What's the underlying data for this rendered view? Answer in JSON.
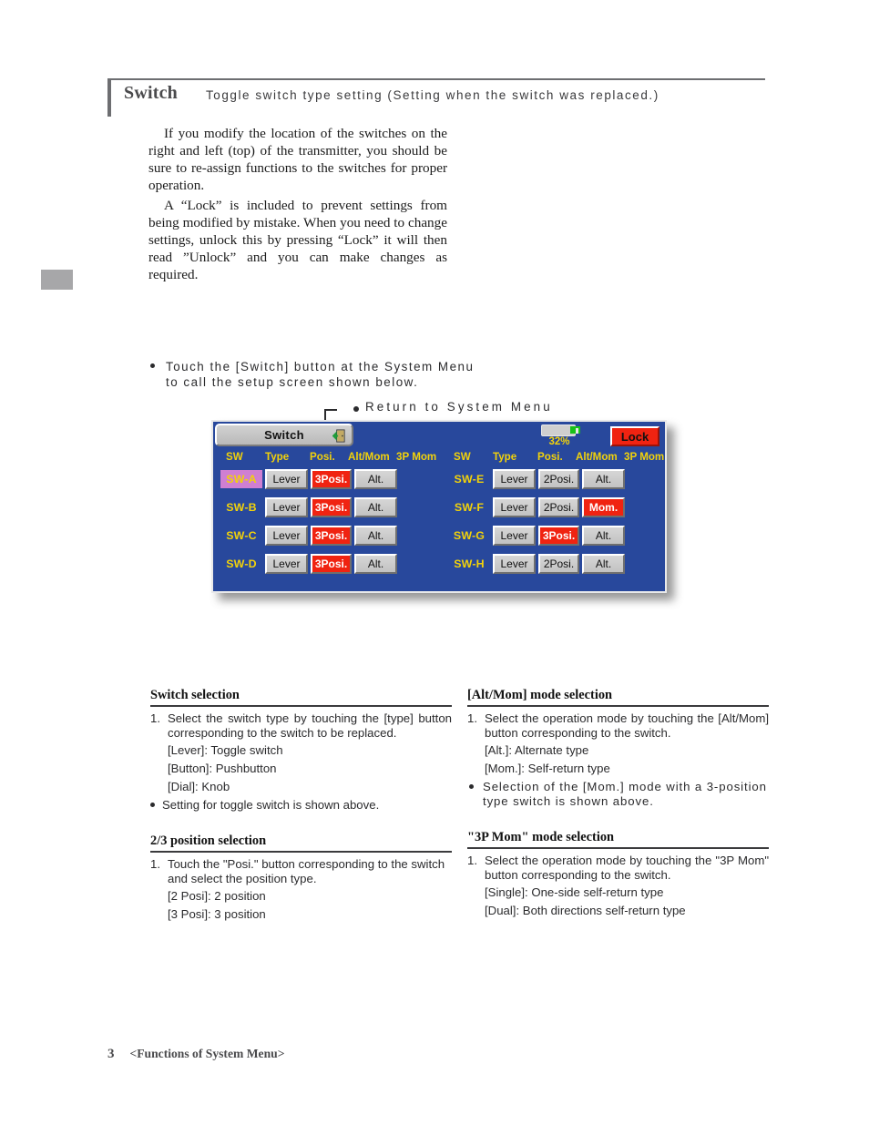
{
  "header": {
    "title": "Switch",
    "subtitle": "Toggle switch type setting (Setting when the switch was replaced.)"
  },
  "intro": {
    "p1": "If you modify the location of the switches on the right and left (top) of the transmitter, you should be sure to re-assign functions to the switches for proper operation.",
    "p2": "A “Lock” is included to prevent settings from being modified by mistake. When you need to change settings, unlock this by pressing “Lock” it will then read ”Unlock” and you can make changes as required."
  },
  "touch_note": "Touch the [Switch] button at the System Menu to call the setup screen shown below.",
  "callout": {
    "label": "Return to System Menu"
  },
  "lcd": {
    "title": "Switch",
    "exit_icon": "exit-door-icon",
    "battery": {
      "percent_label": "32%",
      "level": 32,
      "fill_color": "#18c218"
    },
    "lock_button": "Lock",
    "column_headers": [
      "SW",
      "Type",
      "Posi.",
      "Alt/Mom",
      "3P Mom"
    ],
    "left_rows": [
      {
        "sw": "SW-A",
        "selected": true,
        "type": "Lever",
        "type_on": false,
        "posi": "3Posi.",
        "posi_on": true,
        "altmom": "Alt.",
        "altmom_on": false,
        "p3mom": ""
      },
      {
        "sw": "SW-B",
        "selected": false,
        "type": "Lever",
        "type_on": false,
        "posi": "3Posi.",
        "posi_on": true,
        "altmom": "Alt.",
        "altmom_on": false,
        "p3mom": ""
      },
      {
        "sw": "SW-C",
        "selected": false,
        "type": "Lever",
        "type_on": false,
        "posi": "3Posi.",
        "posi_on": true,
        "altmom": "Alt.",
        "altmom_on": false,
        "p3mom": ""
      },
      {
        "sw": "SW-D",
        "selected": false,
        "type": "Lever",
        "type_on": false,
        "posi": "3Posi.",
        "posi_on": true,
        "altmom": "Alt.",
        "altmom_on": false,
        "p3mom": ""
      }
    ],
    "right_rows": [
      {
        "sw": "SW-E",
        "selected": false,
        "type": "Lever",
        "type_on": false,
        "posi": "2Posi.",
        "posi_on": false,
        "altmom": "Alt.",
        "altmom_on": false,
        "p3mom": ""
      },
      {
        "sw": "SW-F",
        "selected": false,
        "type": "Lever",
        "type_on": false,
        "posi": "2Posi.",
        "posi_on": false,
        "altmom": "Mom.",
        "altmom_on": true,
        "p3mom": ""
      },
      {
        "sw": "SW-G",
        "selected": false,
        "type": "Lever",
        "type_on": false,
        "posi": "3Posi.",
        "posi_on": true,
        "altmom": "Alt.",
        "altmom_on": false,
        "p3mom": ""
      },
      {
        "sw": "SW-H",
        "selected": false,
        "type": "Lever",
        "type_on": false,
        "posi": "2Posi.",
        "posi_on": false,
        "altmom": "Alt.",
        "altmom_on": false,
        "p3mom": ""
      }
    ],
    "colors": {
      "screen_bg": "#28489c",
      "accent_red": "#f02311",
      "header_yellow": "#f2d20a",
      "selection_magenta": "#cf7fd2",
      "button_gray": "#c8c8c8"
    }
  },
  "blocks": {
    "switch_selection": {
      "heading": "Switch selection",
      "step_num": "1.",
      "step_text": "Select the switch type by touching the [type] button corresponding to the switch to be replaced.",
      "options": [
        "[Lever]: Toggle switch",
        "[Button]: Pushbutton",
        "[Dial]: Knob"
      ],
      "note": "Setting for toggle switch is shown above."
    },
    "position_selection": {
      "heading": "2/3 position selection",
      "step_num": "1.",
      "step_text": "Touch the \"Posi.\" button corresponding to the switch and select the position type.",
      "options": [
        "[2 Posi]: 2 position",
        "[3 Posi]: 3 position"
      ]
    },
    "altmom_selection": {
      "heading": "[Alt/Mom] mode selection",
      "step_num": "1.",
      "step_text": "Select the operation mode by touching the [Alt/Mom] button corresponding to the switch.",
      "options": [
        "[Alt.]: Alternate type",
        "[Mom.]: Self-return type"
      ],
      "note": "Selection of the [Mom.] mode with a 3-position type switch is shown above."
    },
    "p3mom_selection": {
      "heading": "\"3P Mom\" mode selection",
      "step_num": "1.",
      "step_text": "Select the operation mode by touching the \"3P Mom\" button corresponding to the switch.",
      "options": [
        "[Single]: One-side self-return type",
        "[Dual]: Both directions self-return type"
      ]
    }
  },
  "footer": {
    "page_number": "3",
    "section": "<Functions of System Menu>"
  }
}
